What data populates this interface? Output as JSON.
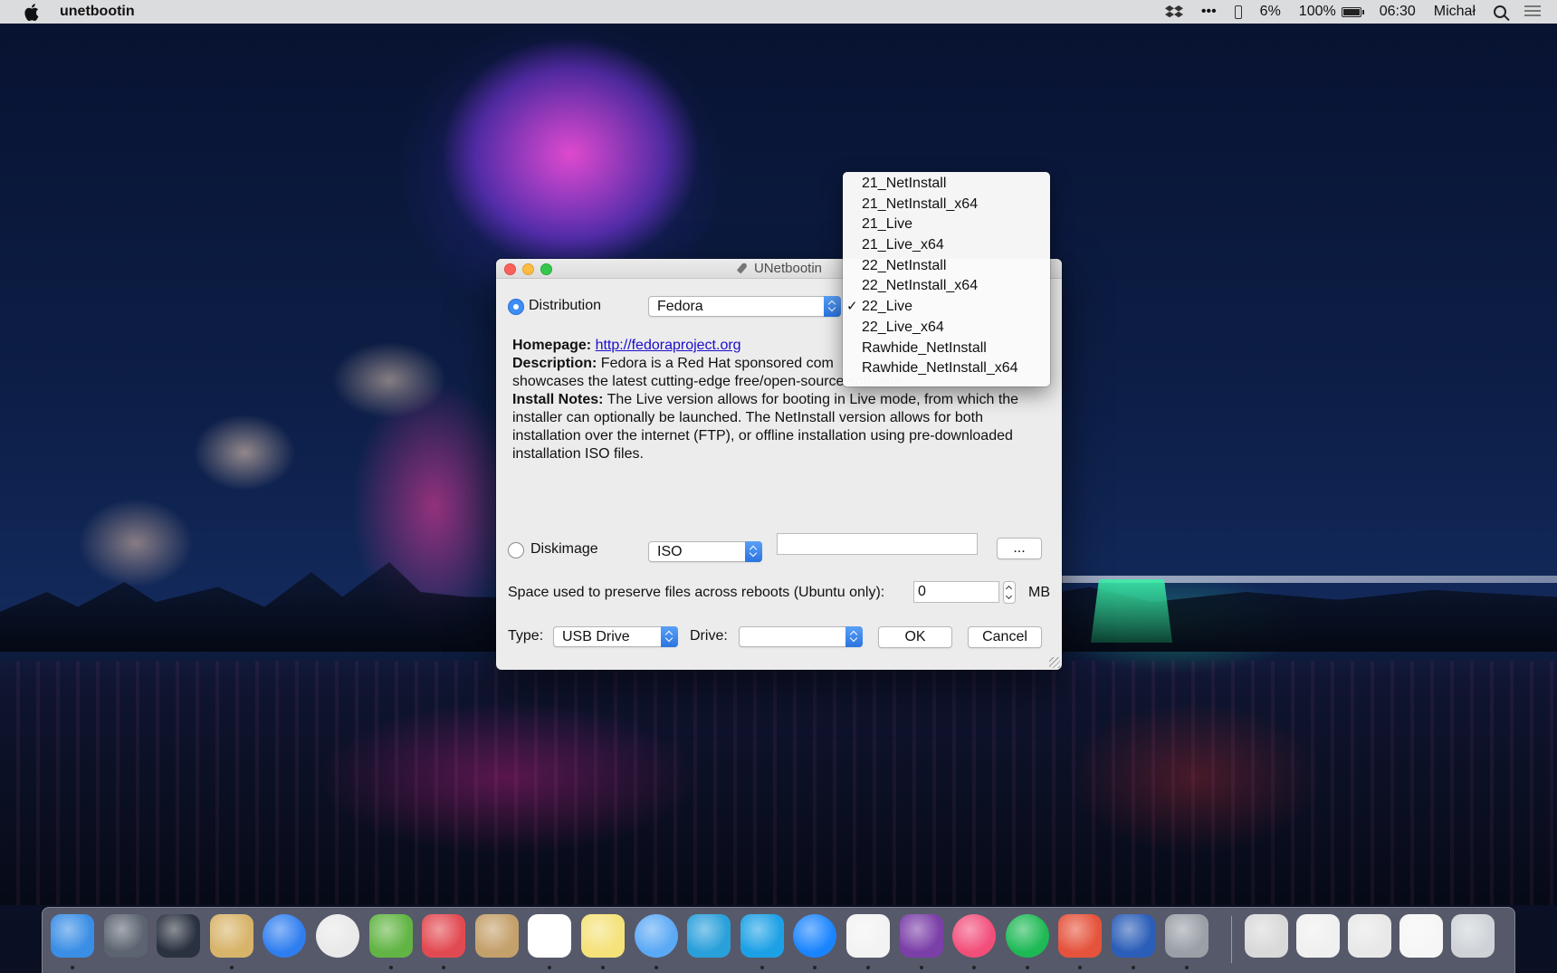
{
  "menubar": {
    "app_name": "unetbootin",
    "more": "•••",
    "percent_small": "6%",
    "battery": "100%",
    "time": "06:30",
    "user": "Michał"
  },
  "window": {
    "title": "UNetbootin",
    "distribution_label": "Distribution",
    "distribution_value": "Fedora",
    "homepage_label": "Homepage:",
    "homepage_link": "http://fedoraproject.org",
    "description_label": "Description:",
    "description_text": "Fedora is a Red Hat sponsored com",
    "description_line2": "showcases the latest cutting-edge free/open-source software.",
    "install_notes_label": "Install Notes:",
    "install_notes_text": "The Live version allows for booting in Live mode, from which the installer can optionally be launched. The NetInstall version allows for both installation over the internet (FTP), or offline installation using pre-downloaded installation ISO files.",
    "diskimage_label": "Diskimage",
    "diskimage_type": "ISO",
    "diskimage_path": "",
    "browse_label": "...",
    "space_label": "Space used to preserve files across reboots (Ubuntu only):",
    "space_value": "0",
    "space_unit": "MB",
    "type_label": "Type:",
    "type_value": "USB Drive",
    "drive_label": "Drive:",
    "drive_value": "",
    "ok_label": "OK",
    "cancel_label": "Cancel"
  },
  "version_popup": {
    "items": [
      "21_NetInstall",
      "21_NetInstall_x64",
      "21_Live",
      "21_Live_x64",
      "22_NetInstall",
      "22_NetInstall_x64",
      "22_Live",
      "22_Live_x64",
      "Rawhide_NetInstall",
      "Rawhide_NetInstall_x64"
    ],
    "selected": "22_Live",
    "check": "✓"
  },
  "dock": {
    "colors": [
      "#3a8ee6",
      "#5b6470",
      "#2a3240",
      "#d8b46a",
      "#2f7ef0",
      "#e9e9e9",
      "#62b544",
      "#e24a52",
      "#c4a06a",
      "#ffffff",
      "#f5e27a",
      "#5aa9f5",
      "#2aa0db",
      "#1da1e6",
      "#1a84ff",
      "#f3f3f3",
      "#7b3fa8",
      "#f24e7a",
      "#1db954",
      "#e5533c",
      "#2b5eb8",
      "#9aa0a8",
      "#d9d9d9",
      "#f0f0f0",
      "#e8e8e8",
      "#f6f6f6",
      "#cfd3d8"
    ]
  }
}
